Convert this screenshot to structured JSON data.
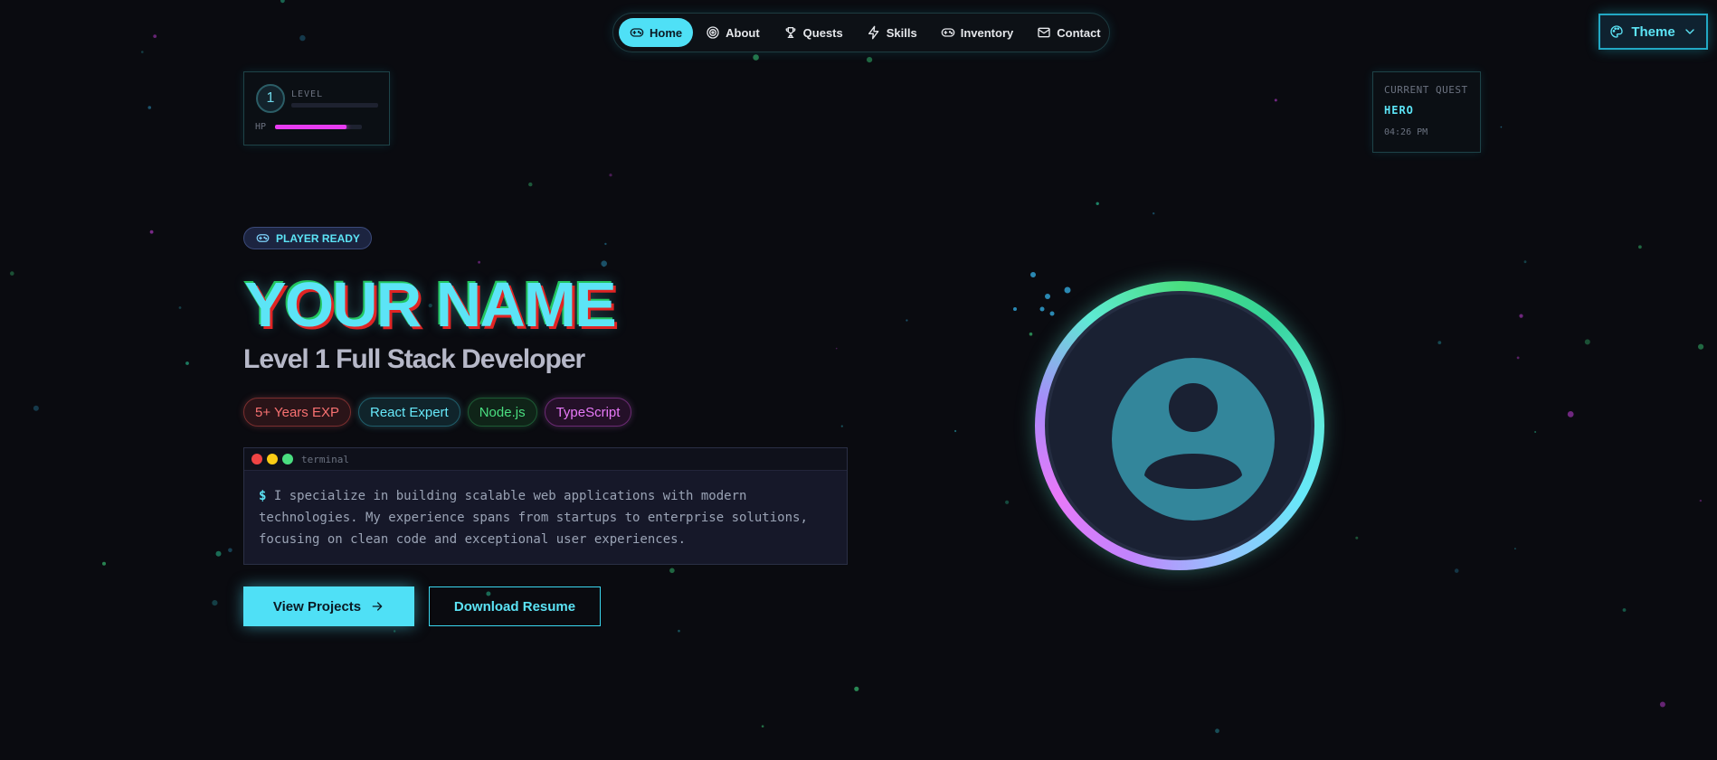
{
  "nav": {
    "items": [
      {
        "label": "Home",
        "icon": "gamepad-icon",
        "active": true
      },
      {
        "label": "About",
        "icon": "target-icon"
      },
      {
        "label": "Quests",
        "icon": "trophy-icon"
      },
      {
        "label": "Skills",
        "icon": "zap-icon"
      },
      {
        "label": "Inventory",
        "icon": "gamepad-icon"
      },
      {
        "label": "Contact",
        "icon": "mail-icon"
      }
    ]
  },
  "theme": {
    "label": "Theme",
    "icon": "palette-icon"
  },
  "player": {
    "level": "1",
    "level_label": "LEVEL",
    "hp_label": "HP",
    "hp_fraction": 0.82,
    "xp_fraction": 0.0
  },
  "quest": {
    "title": "CURRENT QUEST",
    "name": "HERO",
    "time": "04:26 PM"
  },
  "hero": {
    "badge": "PLAYER READY",
    "name": "YOUR NAME",
    "title": "Level 1 Full Stack Developer",
    "tags": [
      "5+ Years EXP",
      "React Expert",
      "Node.js",
      "TypeScript"
    ]
  },
  "terminal": {
    "label": "terminal",
    "prompt": "$",
    "text": "I specialize in building scalable web applications with modern\ntechnologies. My experience spans from startups to enterprise solutions,\nfocusing on clean code and exceptional user experiences."
  },
  "buttons": {
    "primary": "View Projects",
    "secondary": "Download Resume"
  },
  "colors": {
    "accent": "#4fe0f6",
    "hp": "#e83cf2",
    "background": "#0a0b10"
  }
}
